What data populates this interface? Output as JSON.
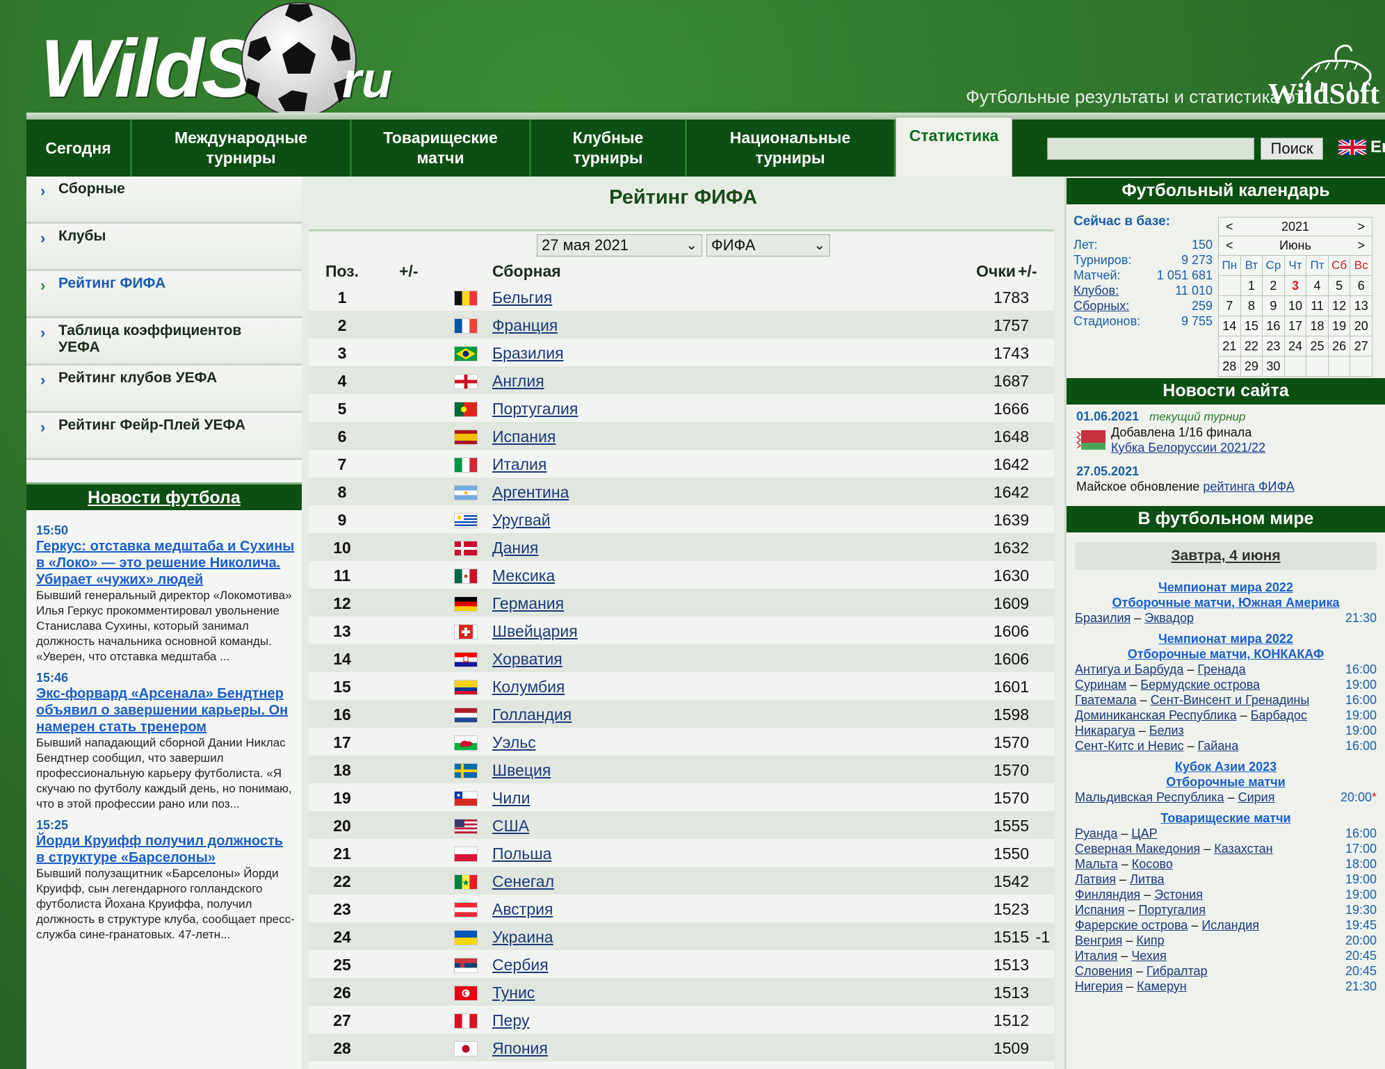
{
  "header": {
    "logo_main": "WildStat",
    "logo_tld": "ru",
    "tagline": "Футбольные результаты и статистика от",
    "tagline_brand": "WildSoft"
  },
  "nav": {
    "items": [
      {
        "label_lines": [
          "Сегодня"
        ]
      },
      {
        "label_lines": [
          "Международные",
          "турниры"
        ]
      },
      {
        "label_lines": [
          "Товарищеские",
          "матчи"
        ]
      },
      {
        "label_lines": [
          "Клубные",
          "турниры"
        ]
      },
      {
        "label_lines": [
          "Национальные",
          "турниры"
        ]
      },
      {
        "label_lines": [
          "Статистика"
        ]
      }
    ],
    "search_value": "",
    "search_button": "Поиск",
    "lang": "En"
  },
  "left_nav": [
    {
      "label_lines": [
        "Сборные"
      ],
      "active": false
    },
    {
      "label_lines": [
        "Клубы"
      ],
      "active": false
    },
    {
      "label_lines": [
        "Рейтинг ФИФА"
      ],
      "active": true
    },
    {
      "label_lines": [
        "Таблица коэффициентов",
        "УЕФА"
      ],
      "active": false
    },
    {
      "label_lines": [
        "Рейтинг клубов УЕФА"
      ],
      "active": false
    },
    {
      "label_lines": [
        "Рейтинг Фейр-Плей УЕФА"
      ],
      "active": false
    }
  ],
  "football_news": {
    "heading": "Новости футбола",
    "items": [
      {
        "time": "15:50",
        "title": "Геркус: отставка медштаба и Сухины в «Локо» — это решение Николича. Убирает «чужих» людей",
        "body": "Бывший генеральный директор «Локомотива» Илья Геркус прокомментировал увольнение Станислава Сухины, который занимал должность начальника основной команды. «Уверен, что отставка медштаба ..."
      },
      {
        "time": "15:46",
        "title": "Экс-форвард «Арсенала» Бендтнер объявил о завершении карьеры. Он намерен стать тренером",
        "body": "Бывший нападающий сборной Дании Никлас Бендтнер сообщил, что завершил профессиональную карьеру футболиста. «Я скучаю по футболу каждый день, но понимаю, что в этой профессии рано или поз..."
      },
      {
        "time": "15:25",
        "title": "Йорди Круифф получил должность в структуре «Барселоны»",
        "body": "Бывший полузащитник «Барселоны» Йорди Круифф, сын легендарного голландского футболиста Йохана Круиффа, получил должность в структуре клуба, сообщает пресс-служба сине-гранатовых. 47-летн..."
      }
    ]
  },
  "ranking": {
    "title": "Рейтинг ФИФА",
    "date_select": "27 мая 2021",
    "org_select": "ФИФА",
    "columns": {
      "pos": "Поз.",
      "change": "+/-",
      "team": "Сборная",
      "points": "Очки",
      "diff": "+/-"
    },
    "rows": [
      {
        "pos": "1",
        "flag": "belgium",
        "team": "Бельгия",
        "points": "1783",
        "diff": ""
      },
      {
        "pos": "2",
        "flag": "france",
        "team": "Франция",
        "points": "1757",
        "diff": ""
      },
      {
        "pos": "3",
        "flag": "brazil",
        "team": "Бразилия",
        "points": "1743",
        "diff": ""
      },
      {
        "pos": "4",
        "flag": "england",
        "team": "Англия",
        "points": "1687",
        "diff": ""
      },
      {
        "pos": "5",
        "flag": "portugal",
        "team": "Португалия",
        "points": "1666",
        "diff": ""
      },
      {
        "pos": "6",
        "flag": "spain",
        "team": "Испания",
        "points": "1648",
        "diff": ""
      },
      {
        "pos": "7",
        "flag": "italy",
        "team": "Италия",
        "points": "1642",
        "diff": ""
      },
      {
        "pos": "8",
        "flag": "argentina",
        "team": "Аргентина",
        "points": "1642",
        "diff": ""
      },
      {
        "pos": "9",
        "flag": "uruguay",
        "team": "Уругвай",
        "points": "1639",
        "diff": ""
      },
      {
        "pos": "10",
        "flag": "denmark",
        "team": "Дания",
        "points": "1632",
        "diff": ""
      },
      {
        "pos": "11",
        "flag": "mexico",
        "team": "Мексика",
        "points": "1630",
        "diff": ""
      },
      {
        "pos": "12",
        "flag": "germany",
        "team": "Германия",
        "points": "1609",
        "diff": ""
      },
      {
        "pos": "13",
        "flag": "switzerland",
        "team": "Швейцария",
        "points": "1606",
        "diff": ""
      },
      {
        "pos": "14",
        "flag": "croatia",
        "team": "Хорватия",
        "points": "1606",
        "diff": ""
      },
      {
        "pos": "15",
        "flag": "colombia",
        "team": "Колумбия",
        "points": "1601",
        "diff": ""
      },
      {
        "pos": "16",
        "flag": "netherlands",
        "team": "Голландия",
        "points": "1598",
        "diff": ""
      },
      {
        "pos": "17",
        "flag": "wales",
        "team": "Уэльс",
        "points": "1570",
        "diff": ""
      },
      {
        "pos": "18",
        "flag": "sweden",
        "team": "Швеция",
        "points": "1570",
        "diff": ""
      },
      {
        "pos": "19",
        "flag": "chile",
        "team": "Чили",
        "points": "1570",
        "diff": ""
      },
      {
        "pos": "20",
        "flag": "usa",
        "team": "США",
        "points": "1555",
        "diff": ""
      },
      {
        "pos": "21",
        "flag": "poland",
        "team": "Польша",
        "points": "1550",
        "diff": ""
      },
      {
        "pos": "22",
        "flag": "senegal",
        "team": "Сенегал",
        "points": "1542",
        "diff": ""
      },
      {
        "pos": "23",
        "flag": "austria",
        "team": "Австрия",
        "points": "1523",
        "diff": ""
      },
      {
        "pos": "24",
        "flag": "ukraine",
        "team": "Украина",
        "points": "1515",
        "diff": "-1"
      },
      {
        "pos": "25",
        "flag": "serbia",
        "team": "Сербия",
        "points": "1513",
        "diff": ""
      },
      {
        "pos": "26",
        "flag": "tunisia",
        "team": "Тунис",
        "points": "1513",
        "diff": ""
      },
      {
        "pos": "27",
        "flag": "peru",
        "team": "Перу",
        "points": "1512",
        "diff": ""
      },
      {
        "pos": "28",
        "flag": "japan",
        "team": "Япония",
        "points": "1509",
        "diff": ""
      }
    ]
  },
  "calendar_panel": {
    "heading": "Футбольный календарь",
    "stats_title": "Сейчас в базе:",
    "stats": [
      {
        "label": "Лет:",
        "value": "150",
        "link": false
      },
      {
        "label": "Турниров:",
        "value": "9 273",
        "link": false
      },
      {
        "label": "Матчей:",
        "value": "1 051 681",
        "link": false
      },
      {
        "label": "Клубов:",
        "value": "11 010",
        "link": true
      },
      {
        "label": "Сборных:",
        "value": "259",
        "link": true
      },
      {
        "label": "Стадионов:",
        "value": "9 755",
        "link": false
      }
    ],
    "year": "2021",
    "month": "Июнь",
    "prev": "<",
    "next": ">",
    "weekdays": [
      "Пн",
      "Вт",
      "Ср",
      "Чт",
      "Пт",
      "Сб",
      "Вс"
    ],
    "days": [
      "",
      "1",
      "2",
      "3",
      "4",
      "5",
      "6",
      "7",
      "8",
      "9",
      "10",
      "11",
      "12",
      "13",
      "14",
      "15",
      "16",
      "17",
      "18",
      "19",
      "20",
      "21",
      "22",
      "23",
      "24",
      "25",
      "26",
      "27",
      "28",
      "29",
      "30",
      "",
      "",
      "",
      ""
    ],
    "today": "3"
  },
  "site_news": {
    "heading": "Новости сайта",
    "items": [
      {
        "date": "01.06.2021",
        "tag": "текущий турнир",
        "text": "Добавлена 1/16 финала",
        "link": "Кубка Белоруссии 2021/22"
      },
      {
        "date": "27.05.2021",
        "text": "Майское обновление",
        "link": "рейтинга ФИФА"
      }
    ]
  },
  "world": {
    "heading": "В футбольном мире",
    "day": "Завтра, 4 июня",
    "groups": [
      {
        "tournament": [
          "Чемпионат мира 2022",
          "Отборочные матчи, Южная Америка"
        ],
        "matches": [
          {
            "home": "Бразилия",
            "away": "Эквадор",
            "time": "21:30"
          }
        ]
      },
      {
        "tournament": [
          "Чемпионат мира 2022",
          "Отборочные матчи, КОНКАКАФ"
        ],
        "matches": [
          {
            "home": "Антигуа и Барбуда",
            "away": "Гренада",
            "time": "16:00"
          },
          {
            "home": "Суринам",
            "away": "Бермудские острова",
            "time": "19:00"
          },
          {
            "home": "Гватемала",
            "away": "Сент-Винсент и Гренадины",
            "time": "16:00"
          },
          {
            "home": "Доминиканская Республика",
            "away": "Барбадос",
            "time": "19:00"
          },
          {
            "home": "Никарагуа",
            "away": "Белиз",
            "time": "19:00"
          },
          {
            "home": "Сент-Китс и Невис",
            "away": "Гайана",
            "time": "16:00"
          }
        ]
      },
      {
        "tournament": [
          "Кубок Азии 2023",
          "Отборочные матчи"
        ],
        "matches": [
          {
            "home": "Мальдивская Республика",
            "away": "Сирия",
            "time": "20:00",
            "star": "*"
          }
        ]
      },
      {
        "tournament": [
          "Товарищеские матчи"
        ],
        "matches": [
          {
            "home": "Руанда",
            "away": "ЦАР",
            "time": "16:00"
          },
          {
            "home": "Северная Македония",
            "away": "Казахстан",
            "time": "17:00"
          },
          {
            "home": "Мальта",
            "away": "Косово",
            "time": "18:00"
          },
          {
            "home": "Латвия",
            "away": "Литва",
            "time": "19:00"
          },
          {
            "home": "Финляндия",
            "away": "Эстония",
            "time": "19:00"
          },
          {
            "home": "Испания",
            "away": "Португалия",
            "time": "19:30"
          },
          {
            "home": "Фарерские острова",
            "away": "Исландия",
            "time": "19:45"
          },
          {
            "home": "Венгрия",
            "away": "Кипр",
            "time": "20:00"
          },
          {
            "home": "Италия",
            "away": "Чехия",
            "time": "20:45"
          },
          {
            "home": "Словения",
            "away": "Гибралтар",
            "time": "20:45"
          },
          {
            "home": "Нигерия",
            "away": "Камерун",
            "time": "21:30"
          }
        ]
      }
    ]
  }
}
